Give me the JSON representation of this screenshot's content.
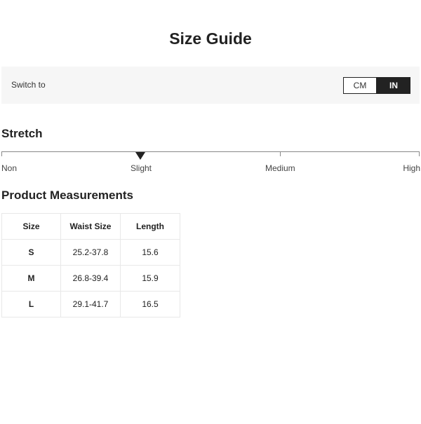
{
  "page": {
    "title": "Size Guide"
  },
  "unit_switch": {
    "label": "Switch to",
    "options": [
      "CM",
      "IN"
    ],
    "selected": "IN"
  },
  "stretch": {
    "heading": "Stretch",
    "levels": [
      "Non",
      "Slight",
      "Medium",
      "High"
    ],
    "current_level": "Slight"
  },
  "measurements": {
    "heading": "Product Measurements",
    "columns": [
      "Size",
      "Waist Size",
      "Length"
    ],
    "rows": [
      {
        "size": "S",
        "waist": "25.2-37.8",
        "length": "15.6"
      },
      {
        "size": "M",
        "waist": "26.8-39.4",
        "length": "15.9"
      },
      {
        "size": "L",
        "waist": "29.1-41.7",
        "length": "16.5"
      }
    ]
  },
  "colors": {
    "accent": "#222222",
    "panel_background": "#f6f6f6",
    "border": "#e8e8e8"
  },
  "icons": {
    "stretch_marker": "triangle-down-icon"
  }
}
